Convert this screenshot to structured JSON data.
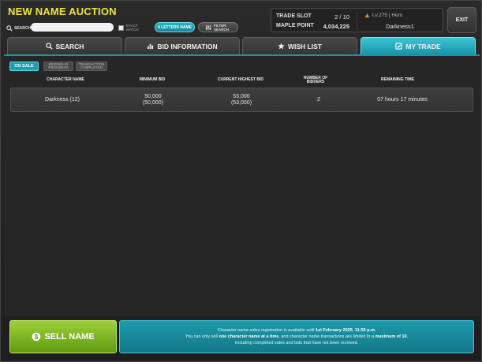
{
  "header": {
    "title": "NEW NAME AUCTION",
    "search_label": "SEARCH",
    "search_value": "",
    "exact_match_label": "EXACT MATCH",
    "four_letters_label": "4 LETTERS NAME",
    "filter_search_label": "FILTER SEARCH"
  },
  "info": {
    "trade_slot_label": "TRADE SLOT",
    "trade_slot_value": "2 / 10",
    "maple_point_label": "MAPLE POINT",
    "maple_point_value": "4,034,225",
    "character_level": "Lv.275 | Hero",
    "character_name": "Darkness1"
  },
  "exit_label": "EXIT",
  "tabs": [
    {
      "label": "SEARCH",
      "icon": "search-icon"
    },
    {
      "label": "BID INFORMATION",
      "icon": "bar-chart-icon"
    },
    {
      "label": "WISH LIST",
      "icon": "star-icon"
    },
    {
      "label": "MY TRADE",
      "icon": "checkbox-icon",
      "active": true
    }
  ],
  "subtabs": {
    "on_sale": "ON SALE",
    "bidding": "BIDDING IN PROGRESS",
    "completed": "TRANSACTION COMPLETED"
  },
  "columns": {
    "character_name": "CHARACTER NAME",
    "minimum_bid": "MINIMUM BID",
    "current_highest_bid": "CURRENT HIGHEST BID",
    "number_of_bidders": "NUMBER OF BIDDERS",
    "remaining_time": "REMAINING TIME"
  },
  "rows": [
    {
      "character_name": "Darkness (12)",
      "minimum_bid": "50,000",
      "minimum_bid_sub": "(50,000)",
      "current_highest_bid": "53,000",
      "current_highest_bid_sub": "(53,000)",
      "number_of_bidders": "2",
      "remaining_time": "07 hours 17 minutes"
    }
  ],
  "footer": {
    "sell_label": "SELL NAME",
    "notice_line1_a": "Character name sales registration is available until ",
    "notice_line1_b": "1st February 2025, 11:59 p.m.",
    "notice_line2_a": "You can only sell ",
    "notice_line2_b": "one character name at a time",
    "notice_line2_c": ", and character name transactions are limited to a ",
    "notice_line2_d": "maximum of 10",
    "notice_line2_e": ",",
    "notice_line3": "including completed sales and bids that have not been received."
  },
  "colors": {
    "title": "#f0e63c",
    "accent_teal": "#1f9db2",
    "sell_green": "#7cb526"
  }
}
